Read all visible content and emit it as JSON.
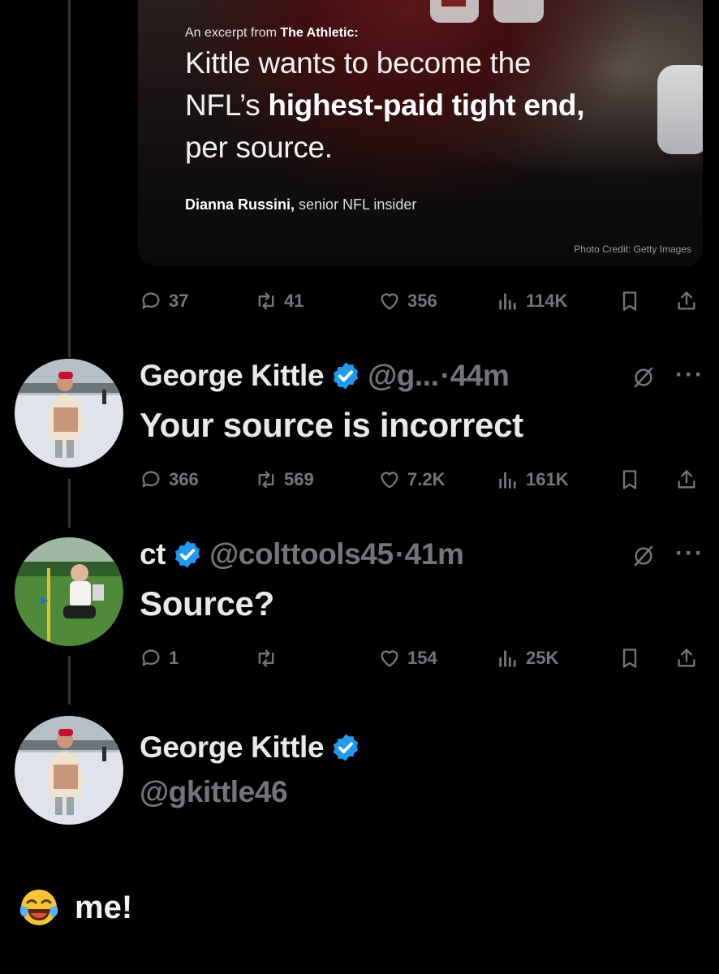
{
  "card": {
    "excerpt_prefix": "An excerpt from ",
    "excerpt_source": "The Athletic:",
    "headline_1": "Kittle wants to become the",
    "headline_2a": "NFL’s ",
    "headline_2b": "highest-paid tight end,",
    "headline_3": "per source.",
    "byline_name": "Dianna Russini,",
    "byline_role": " senior NFL insider",
    "photo_credit": "Photo Credit: Getty Images"
  },
  "tweet0": {
    "replies": "37",
    "reposts": "41",
    "likes": "356",
    "views": "114K"
  },
  "tweet1": {
    "name": "George Kittle",
    "handle": "@g...",
    "time": "·44m",
    "text": "Your source is incorrect",
    "replies": "366",
    "reposts": "569",
    "likes": "7.2K",
    "views": "161K"
  },
  "tweet2": {
    "name": "ct",
    "handle": "@colttools45",
    "time": "·41m",
    "text": "Source?",
    "replies": "1",
    "reposts": "",
    "likes": "154",
    "views": "25K"
  },
  "profile": {
    "name": "George Kittle",
    "handle": "@gkittle46"
  },
  "bottom": {
    "emoji": "face-with-tears-of-joy",
    "text": "me!"
  },
  "colors": {
    "verified": "#1d9bf0",
    "muted": "#71767b",
    "text": "#e7e9ea"
  }
}
